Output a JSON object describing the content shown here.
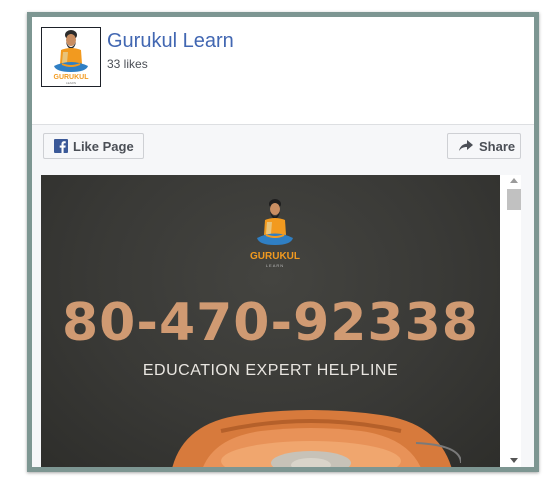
{
  "header": {
    "page_name": "Gurukul Learn",
    "likes": "33 likes",
    "logo_alt": "Gurukul Learn logo",
    "logo_lettering": [
      "GURUKUL",
      "LEARN"
    ]
  },
  "actions": {
    "like_label": "Like Page",
    "share_label": "Share"
  },
  "cover": {
    "phone_number": "80-470-92338",
    "tagline": "EDUCATION EXPERT HELPLINE",
    "logo_lettering": [
      "GURUKUL",
      "LEARN"
    ]
  },
  "icons": {
    "facebook": "facebook-f-icon",
    "share": "share-arrow-icon",
    "scroll_up": "chevron-up-icon",
    "scroll_down": "chevron-down-icon"
  },
  "colors": {
    "frame_border": "#7d9692",
    "link_blue": "#4267b2",
    "facebook_blue": "#3b5998",
    "phone_number": "#d09a72",
    "cover_background": "#393936"
  }
}
